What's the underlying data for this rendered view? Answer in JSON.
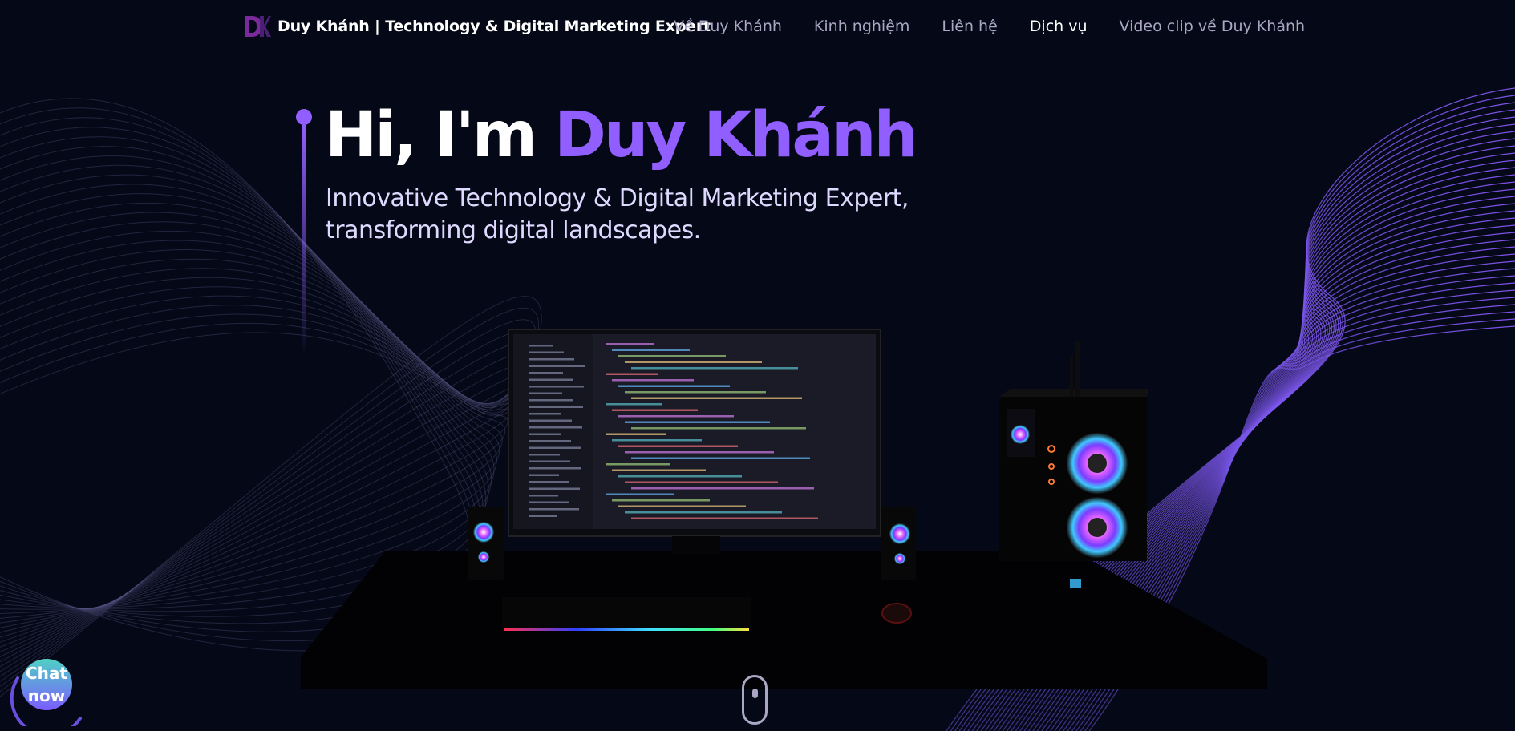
{
  "nav": {
    "brand_title": "Duy Khánh  | Technology & Digital Marketing Expert",
    "links": [
      {
        "label": "Về Duy Khánh",
        "active": false
      },
      {
        "label": "Kinh nghiệm",
        "active": false
      },
      {
        "label": "Liên hệ",
        "active": false
      },
      {
        "label": "Dịch vụ",
        "active": true
      },
      {
        "label": "Video clip về Duy Khánh",
        "active": false
      }
    ]
  },
  "hero": {
    "greeting": "Hi, I'm ",
    "name": "Duy Khánh",
    "subtitle_line1": "Innovative Technology & Digital Marketing Expert,",
    "subtitle_line2": "transforming digital landscapes."
  },
  "chat": {
    "line1": "Chat",
    "line2": "now"
  },
  "icons": {
    "logo": "dk-logo-icon",
    "scroll": "mouse-scroll-icon"
  },
  "colors": {
    "background": "#050816",
    "accent": "#915eff",
    "nav_text": "#aaa6c3",
    "heading": "#ffffff"
  }
}
